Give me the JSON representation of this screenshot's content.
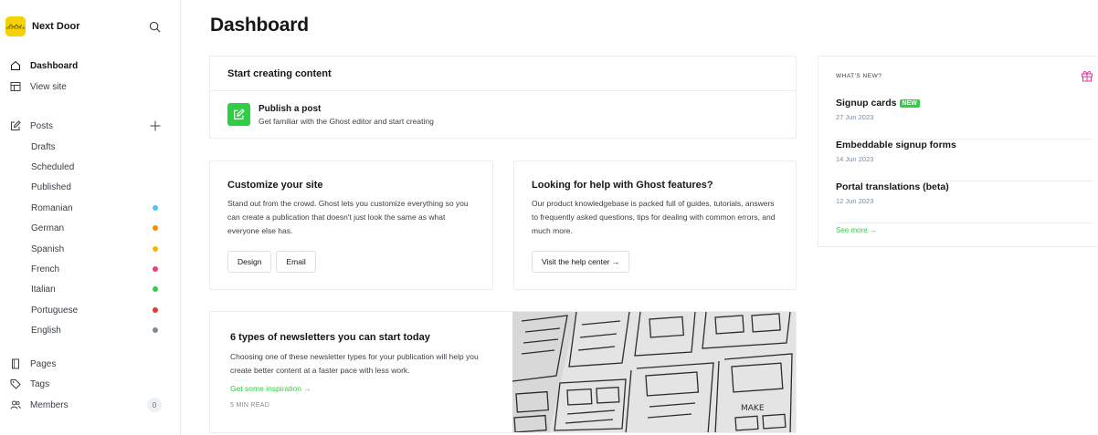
{
  "brand": {
    "name": "Next Door",
    "logo_text": "NEXTDOOR"
  },
  "sidebar": {
    "main": [
      {
        "label": "Dashboard",
        "icon": "home-icon",
        "active": true
      },
      {
        "label": "View site",
        "icon": "layout-icon"
      }
    ],
    "posts": {
      "label": "Posts",
      "icon": "edit-icon"
    },
    "post_filters": [
      {
        "label": "Drafts"
      },
      {
        "label": "Scheduled"
      },
      {
        "label": "Published"
      },
      {
        "label": "Romanian",
        "color": "#4fc3f7"
      },
      {
        "label": "German",
        "color": "#fb8c00"
      },
      {
        "label": "Spanish",
        "color": "#ffb300"
      },
      {
        "label": "French",
        "color": "#ec407a"
      },
      {
        "label": "Italian",
        "color": "#30cf43"
      },
      {
        "label": "Portuguese",
        "color": "#e53935"
      },
      {
        "label": "English",
        "color": "#7c8b9a"
      }
    ],
    "bottom": [
      {
        "label": "Pages",
        "icon": "page-icon"
      },
      {
        "label": "Tags",
        "icon": "tag-icon"
      },
      {
        "label": "Members",
        "icon": "members-icon",
        "count": "0"
      }
    ]
  },
  "main": {
    "title": "Dashboard",
    "start_card": {
      "title": "Start creating content",
      "publish_title": "Publish a post",
      "publish_desc": "Get familiar with the Ghost editor and start creating"
    },
    "customize_card": {
      "title": "Customize your site",
      "body": "Stand out from the crowd. Ghost lets you customize everything so you can create a publication that doesn't just look the same as what everyone else has.",
      "buttons": [
        "Design",
        "Email"
      ]
    },
    "help_card": {
      "title": "Looking for help with Ghost features?",
      "body": "Our product knowledgebase is packed full of guides, tutorials, answers to frequently asked questions, tips for dealing with common errors, and much more.",
      "button": "Visit the help center →"
    },
    "newsletter_card": {
      "title": "6 types of newsletters you can start today",
      "body": "Choosing one of these newsletter types for your publication will help you create better content at a faster pace with less work.",
      "link": "Get some inspiration →",
      "read_time": "5 MIN READ"
    }
  },
  "whats_new": {
    "heading": "WHAT'S NEW?",
    "items": [
      {
        "title": "Signup cards",
        "badge": "NEW",
        "date": "27 Jun 2023"
      },
      {
        "title": "Embeddable signup forms",
        "date": "14 Jun 2023"
      },
      {
        "title": "Portal translations (beta)",
        "date": "12 Jun 2023"
      }
    ],
    "see_more": "See more →"
  },
  "colors": {
    "accent": "#30cf43",
    "gift": "#e0359c",
    "brand_logo": "#f5d300"
  }
}
